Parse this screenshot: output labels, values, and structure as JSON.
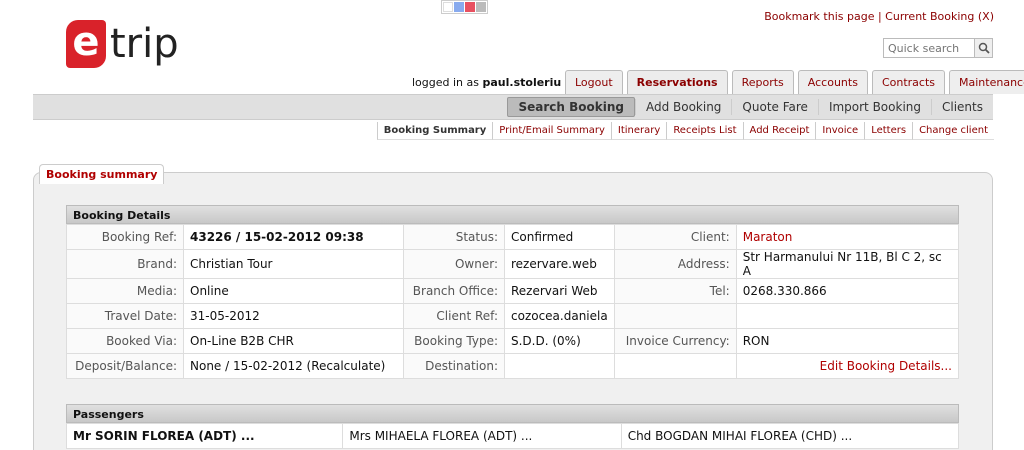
{
  "swatch_colors": [
    "#ffffff",
    "#88aaee",
    "#e85060",
    "#bbbbbb"
  ],
  "logo": {
    "letter": "e",
    "word": "trip"
  },
  "top_links": {
    "bookmark": "Bookmark this page",
    "separator": " | ",
    "current": "Current Booking (X)"
  },
  "search": {
    "placeholder": "Quick search",
    "icon": "search-icon"
  },
  "user": {
    "prefix": "logged in as ",
    "name": "paul.stoleriu"
  },
  "tabs": [
    "Logout",
    "Reservations",
    "Reports",
    "Accounts",
    "Contracts",
    "Maintenance"
  ],
  "subnav": [
    "Search Booking",
    "Add Booking",
    "Quote Fare",
    "Import Booking",
    "Clients"
  ],
  "subnav2": [
    "Booking Summary",
    "Print/Email Summary",
    "Itinerary",
    "Receipts List",
    "Add Receipt",
    "Invoice",
    "Letters",
    "Change client"
  ],
  "panel_title": "Booking summary",
  "details": {
    "title": "Booking Details",
    "rows": [
      [
        "Booking Ref:",
        "43226 / 15-02-2012 09:38",
        "Status:",
        "Confirmed",
        "Client:",
        "Maraton"
      ],
      [
        "Brand:",
        "Christian Tour",
        "Owner:",
        "rezervare.web",
        "Address:",
        "Str Harmanului Nr 11B, Bl C 2, sc A"
      ],
      [
        "Media:",
        "Online",
        "Branch Office:",
        "Rezervari Web",
        "Tel:",
        "0268.330.866"
      ],
      [
        "Travel Date:",
        "31-05-2012",
        "Client Ref:",
        "cozocea.daniela",
        "",
        ""
      ],
      [
        "Booked Via:",
        "On-Line B2B CHR",
        "Booking Type:",
        "S.D.D. (0%)",
        "Invoice Currency:",
        "RON"
      ],
      [
        "Deposit/Balance:",
        "None / 15-02-2012 (Recalculate)",
        "Destination:",
        "",
        "",
        "Edit Booking Details..."
      ]
    ]
  },
  "passengers": {
    "title": "Passengers",
    "items": [
      "Mr SORIN FLOREA (ADT) ...",
      "Mrs MIHAELA FLOREA (ADT) ...",
      "Chd BOGDAN MIHAI FLOREA (CHD) ..."
    ]
  }
}
